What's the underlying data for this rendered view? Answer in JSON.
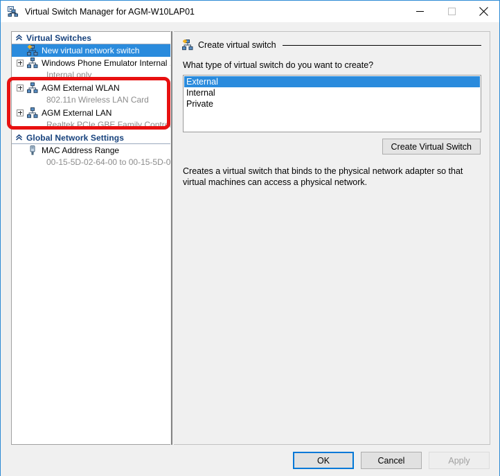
{
  "window": {
    "title": "Virtual Switch Manager for AGM-W10LAP01",
    "icon": "virtual-switch-icon",
    "controls": {
      "minimize": "minimize-icon",
      "maximize": "maximize-icon",
      "close": "close-icon"
    }
  },
  "tree": {
    "groups": [
      {
        "header": "Virtual Switches",
        "nodes": [
          {
            "label": "New virtual network switch",
            "sub": "",
            "icon": "new-virtual-switch-icon",
            "expandable": false,
            "selected": true
          },
          {
            "label": "Windows Phone Emulator Internal ...",
            "sub": "Internal only",
            "icon": "virtual-switch-icon",
            "expandable": true,
            "selected": false
          },
          {
            "label": "AGM External WLAN",
            "sub": "802.11n Wireless LAN Card",
            "icon": "virtual-switch-icon",
            "expandable": true,
            "selected": false
          },
          {
            "label": "AGM External LAN",
            "sub": "Realtek PCIe GBE Family Controller",
            "icon": "virtual-switch-icon",
            "expandable": true,
            "selected": false
          }
        ]
      },
      {
        "header": "Global Network Settings",
        "nodes": [
          {
            "label": "MAC Address Range",
            "sub": "00-15-5D-02-64-00 to 00-15-5D-0...",
            "icon": "mac-address-icon",
            "expandable": false,
            "selected": false
          }
        ]
      }
    ]
  },
  "right_panel": {
    "header": "Create virtual switch",
    "header_icon": "new-virtual-switch-icon",
    "question": "What type of virtual switch do you want to create?",
    "options": [
      {
        "label": "External",
        "selected": true
      },
      {
        "label": "Internal",
        "selected": false
      },
      {
        "label": "Private",
        "selected": false
      }
    ],
    "create_button": "Create Virtual Switch",
    "description": "Creates a virtual switch that binds to the physical network adapter so that virtual machines can access a physical network."
  },
  "footer": {
    "ok": "OK",
    "cancel": "Cancel",
    "apply": "Apply"
  },
  "annotation": {
    "color": "#e81010",
    "shape": "rounded-rectangle-highlight"
  },
  "colors": {
    "selection": "#2a8bdd",
    "group_header_text": "#16417c",
    "window_border": "#2c8ad4",
    "focus_border": "#0078d7",
    "annotation": "#e81010"
  }
}
